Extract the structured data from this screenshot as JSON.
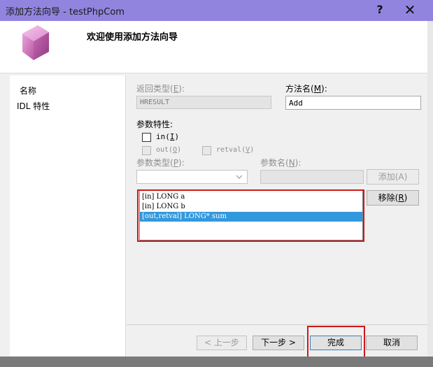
{
  "window": {
    "title": "添加方法向导 - testPhpCom",
    "help_glyph": "?",
    "close_glyph": "✕"
  },
  "banner": {
    "heading": "欢迎使用添加方法向导",
    "icon": "pink-cube-icon"
  },
  "nav": {
    "items": [
      {
        "label": "名称"
      },
      {
        "label": "IDL 特性"
      }
    ]
  },
  "form": {
    "return_type_label": "返回类型(",
    "return_type_key": "E",
    "return_type_label_tail": "):",
    "return_type_value": "HRESULT",
    "method_name_label": "方法名(",
    "method_name_key": "M",
    "method_name_label_tail": "):",
    "method_name_value": "Add",
    "param_attrs_label": "参数特性:",
    "in_label": "in(",
    "in_key": "I",
    "in_label_tail": ")",
    "out_label": "out(",
    "out_key": "O",
    "out_label_tail": ")",
    "retval_label": "retval(",
    "retval_key": "V",
    "retval_label_tail": ")",
    "param_type_label": "参数类型(",
    "param_type_key": "P",
    "param_type_label_tail": "):",
    "param_type_value": "",
    "param_name_label": "参数名(",
    "param_name_key": "N",
    "param_name_label_tail": "):",
    "param_name_value": "",
    "add_button": "添加(A)",
    "remove_button": "移除(",
    "remove_key": "R",
    "remove_tail": ")",
    "params": [
      {
        "text": "[in] LONG a",
        "selected": false
      },
      {
        "text": "[in] LONG b",
        "selected": false
      },
      {
        "text": "[out,retval] LONG* sum",
        "selected": true
      }
    ]
  },
  "footer": {
    "prev_button": "< 上一步",
    "next_button": "下一步 >",
    "finish_button": "完成",
    "cancel_button": "取消"
  },
  "colors": {
    "titlebar": "#9184de",
    "selection": "#3399dd",
    "highlight_box": "#d01818"
  }
}
